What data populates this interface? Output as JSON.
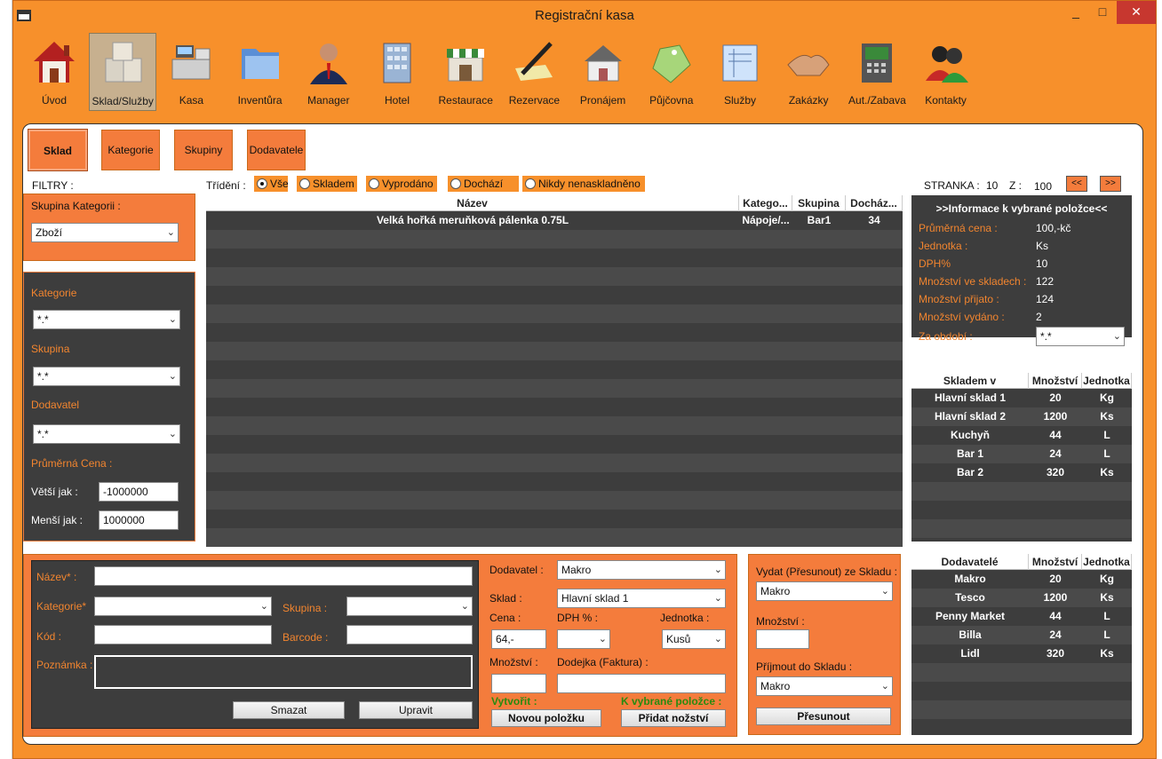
{
  "window": {
    "title": "Registrační kasa",
    "min": "_",
    "max": "□",
    "close": "✕"
  },
  "toolbar": [
    {
      "label": "Úvod",
      "icon": "house-icon"
    },
    {
      "label": "Sklad/Služby",
      "icon": "boxes-icon"
    },
    {
      "label": "Kasa",
      "icon": "cash-register-icon"
    },
    {
      "label": "Inventůra",
      "icon": "folder-icon"
    },
    {
      "label": "Manager",
      "icon": "manager-icon"
    },
    {
      "label": "Hotel",
      "icon": "building-icon"
    },
    {
      "label": "Restaurace",
      "icon": "shop-icon"
    },
    {
      "label": "Rezervace",
      "icon": "pen-icon"
    },
    {
      "label": "Pronájem",
      "icon": "house-rent-icon"
    },
    {
      "label": "Půjčovna",
      "icon": "price-tag-icon"
    },
    {
      "label": "Služby",
      "icon": "blueprint-icon"
    },
    {
      "label": "Zakázky",
      "icon": "handshake-icon"
    },
    {
      "label": "Aut./Zabava",
      "icon": "atm-icon"
    },
    {
      "label": "Kontakty",
      "icon": "contacts-icon"
    }
  ],
  "tabs": [
    "Sklad",
    "Kategorie",
    "Skupiny",
    "Dodavatele"
  ],
  "filters_label": "FILTRY :",
  "sort": {
    "label": "Třídění :",
    "options": [
      "Vše",
      "Skladem",
      "Vyprodáno",
      "Dochází",
      "Nikdy nenaskladněno"
    ]
  },
  "paging": {
    "stranka_label": "STRANKA :",
    "page": "10",
    "z_label": "Z :",
    "total": "100",
    "prev": "<<",
    "next": ">>"
  },
  "left": {
    "group_label": "Skupina Kategorii :",
    "group_value": "Zboží",
    "kategorie_label": "Kategorie",
    "kategorie_value": "*.*",
    "skupina_label": "Skupina",
    "skupina_value": "*.*",
    "dodavatel_label": "Dodavatel",
    "dodavatel_value": "*.*",
    "cena_label": "Průměrná Cena :",
    "vetsi_label": "Větší jak :",
    "vetsi_value": "-1000000",
    "mensi_label": "Menší jak :",
    "mensi_value": "1000000"
  },
  "main_grid": {
    "headers": [
      "Název",
      "Katego...",
      "Skupina",
      "Docház..."
    ],
    "rows": [
      [
        "Velká hořká meruňková pálenka 0.75L",
        "Nápoje/...",
        "Bar1",
        "34"
      ]
    ]
  },
  "info": {
    "title": ">>Informace k vybrané položce<<",
    "rows": [
      {
        "label": "Průměrná cena :",
        "value": "100,-kč"
      },
      {
        "label": "Jednotka :",
        "value": "Ks"
      },
      {
        "label": "DPH%",
        "value": "10"
      },
      {
        "label": "Množství ve skladech :",
        "value": "122"
      },
      {
        "label": "Množství přijato :",
        "value": "124"
      },
      {
        "label": "Množství vydáno :",
        "value": "2"
      }
    ],
    "obdobi_label": "Za období :",
    "obdobi_value": "*.*"
  },
  "stock_grid": {
    "headers": [
      "Skladem v",
      "Množství",
      "Jednotka"
    ],
    "rows": [
      [
        "Hlavní sklad 1",
        "20",
        "Kg"
      ],
      [
        "Hlavní sklad 2",
        "1200",
        "Ks"
      ],
      [
        "Kuchyň",
        "44",
        "L"
      ],
      [
        "Bar 1",
        "24",
        "L"
      ],
      [
        "Bar 2",
        "320",
        "Ks"
      ]
    ]
  },
  "supplier_grid": {
    "headers": [
      "Dodavatelé",
      "Množství",
      "Jednotka"
    ],
    "rows": [
      [
        "Makro",
        "20",
        "Kg"
      ],
      [
        "Tesco",
        "1200",
        "Ks"
      ],
      [
        "Penny Market",
        "44",
        "L"
      ],
      [
        "Billa",
        "24",
        "L"
      ],
      [
        "Lidl",
        "320",
        "Ks"
      ]
    ]
  },
  "edit": {
    "nazev_label": "Název* :",
    "kategorie_label": "Kategorie*",
    "skupina_label": "Skupina :",
    "kod_label": "Kód :",
    "barcode_label": "Barcode :",
    "poznamka_label": "Poznámka :",
    "smazat": "Smazat",
    "upravit": "Upravit"
  },
  "item": {
    "dodavatel_label": "Dodavatel :",
    "dodavatel_value": "Makro",
    "sklad_label": "Sklad :",
    "sklad_value": "Hlavní sklad 1",
    "cena_label": "Cena :",
    "cena_value": "64,-",
    "dph_label": "DPH % :",
    "jednotka_label": "Jednotka :",
    "jednotka_value": "Kusů",
    "mnozstvi_label": "Množství :",
    "dodejka_label": "Dodejka (Faktura) :",
    "vytvorit_label": "Vytvořit :",
    "k_vybrane_label": "K vybrané položce :",
    "nova_btn": "Novou položku",
    "pridat_btn": "Přidat nožství"
  },
  "transfer": {
    "vydat_label": "Vydat (Přesunout) ze Skladu :",
    "vydat_value": "Makro",
    "mnozstvi_label": "Množství :",
    "prijmout_label": "Příjmout do Skladu :",
    "prijmout_value": "Makro",
    "presunout_btn": "Přesunout"
  },
  "colors": {
    "accent": "#f7902b",
    "panel_dark": "#3d3d3d",
    "label_orange": "#f2852f",
    "green": "#2a8a10"
  }
}
